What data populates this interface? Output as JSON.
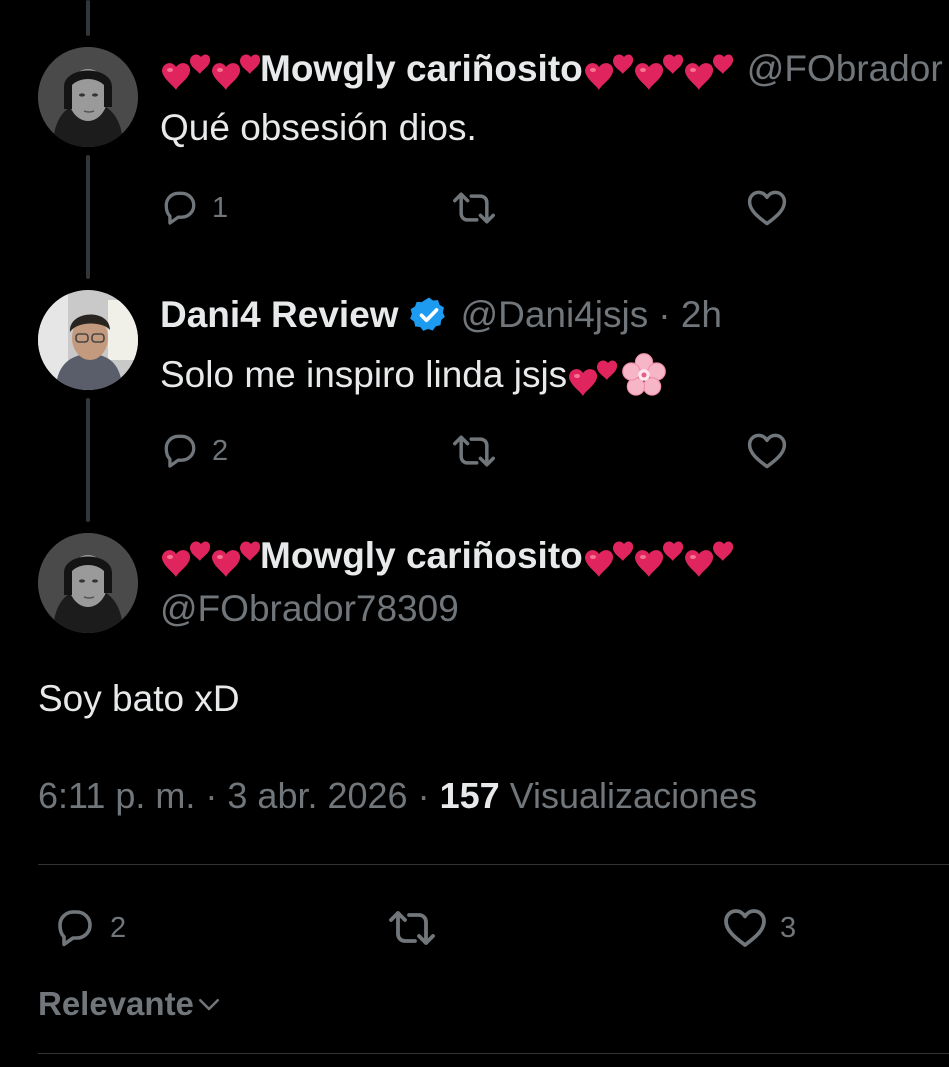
{
  "replies": [
    {
      "display_name": "Mowgly cariñosito",
      "handle": "@FObrador",
      "text": "Qué obsesión dios.",
      "actions": {
        "reply_count": "1"
      }
    },
    {
      "display_name": "Dani4 Review",
      "handle": "@Dani4jsjs",
      "time": "· 2h",
      "text": "Solo me inspiro linda jsjs",
      "actions": {
        "reply_count": "2"
      }
    }
  ],
  "main_post": {
    "display_name": "Mowgly cariñosito",
    "handle": "@FObrador78309",
    "text": "Soy bato xD",
    "timestamp": "6:11 p. m. · 3 abr. 2026 · ",
    "views_count": "157",
    "views_label": " Visualizaciones",
    "actions": {
      "reply_count": "2",
      "like_count": "3"
    }
  },
  "sort": {
    "label": "Relevante"
  },
  "colors": {
    "accent_verified": "#1d9bf0",
    "muted": "#71767b",
    "text": "#e7e9ea",
    "heart_emoji": "#e0245e"
  },
  "icons": [
    "reply-icon",
    "repost-icon",
    "like-icon",
    "verified-badge-icon",
    "two-hearts-emoji",
    "cherry-blossom-emoji",
    "chevron-down-icon"
  ]
}
